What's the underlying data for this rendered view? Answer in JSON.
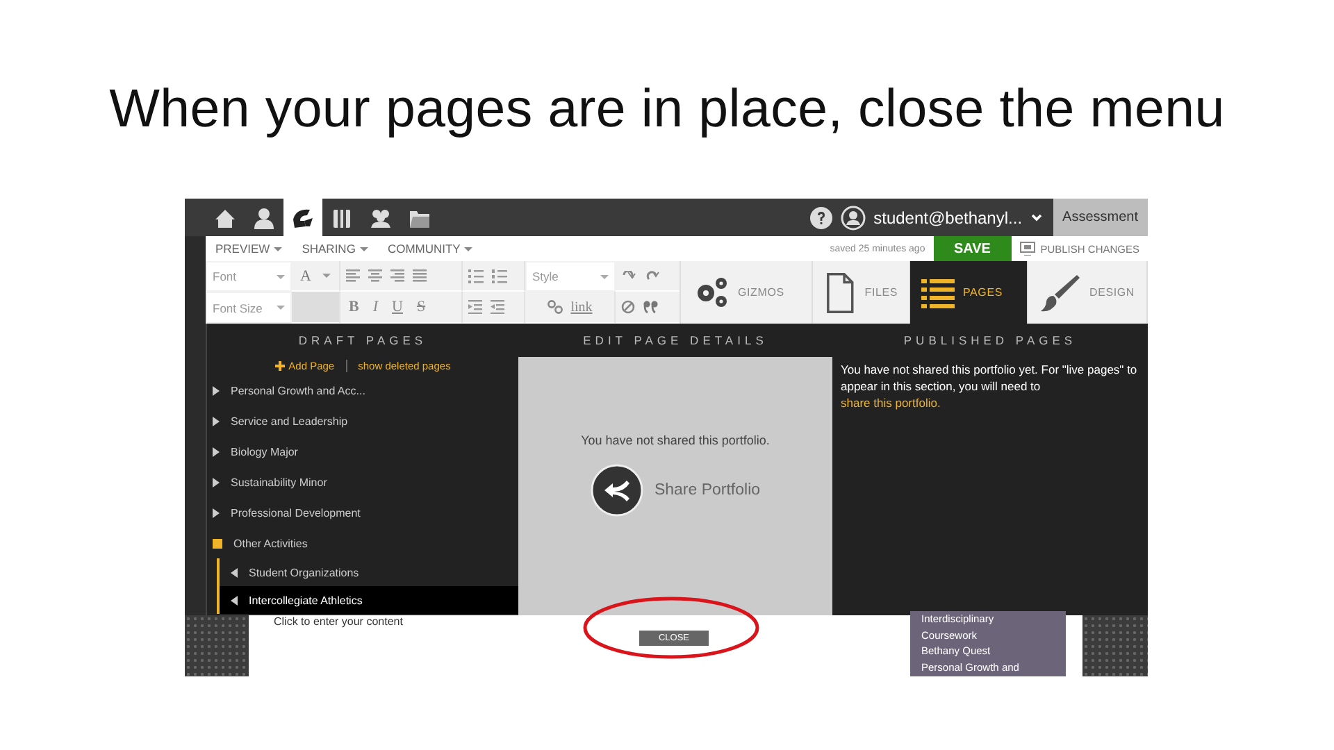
{
  "slide": {
    "title": "When your pages are in place, close the menu"
  },
  "nav_tabs": [
    {
      "selected": false
    },
    {
      "selected": false
    },
    {
      "selected": true
    },
    {
      "selected": false
    },
    {
      "selected": false
    },
    {
      "selected": false
    }
  ],
  "account": {
    "user": "student@bethanyl...",
    "portfolio": "Assessment"
  },
  "menus": [
    "PREVIEW",
    "SHARING",
    "COMMUNITY"
  ],
  "saved_status": "saved 25 minutes ago",
  "save_button": "SAVE",
  "publish_button": "PUBLISH CHANGES",
  "toolbar": {
    "font": "Font",
    "font_size": "Font Size",
    "style": "Style",
    "link": "link",
    "letters": [
      {
        "label": "A",
        "kind": "color"
      },
      {
        "label": "B",
        "kind": "bold"
      },
      {
        "label": "I",
        "kind": "italic"
      },
      {
        "label": "U",
        "kind": "underline"
      },
      {
        "label": "S",
        "kind": "strike"
      }
    ]
  },
  "panel_tabs": [
    {
      "label": "GIZMOS",
      "selected": false
    },
    {
      "label": "FILES",
      "selected": false
    },
    {
      "label": "PAGES",
      "selected": true
    },
    {
      "label": "DESIGN",
      "selected": false
    }
  ],
  "draft_pages": {
    "heading": "DRAFT PAGES",
    "add_page": "Add Page",
    "show_deleted": "show deleted pages",
    "pages": [
      {
        "label": "Personal Growth and Acc...",
        "expanded": false,
        "selected": false
      },
      {
        "label": "Service and Leadership",
        "expanded": false,
        "selected": false
      },
      {
        "label": "Biology Major",
        "expanded": false,
        "selected": false
      },
      {
        "label": "Sustainability Minor",
        "expanded": false,
        "selected": false
      },
      {
        "label": "Professional Development",
        "expanded": false,
        "selected": false
      },
      {
        "label": "Other Activities",
        "expanded": true,
        "selected": false,
        "children": [
          {
            "label": "Student Organizations",
            "selected": false
          },
          {
            "label": "Intercollegiate Athletics",
            "selected": true
          }
        ]
      }
    ]
  },
  "edit_details": {
    "heading": "EDIT PAGE DETAILS",
    "message": "You have not shared this portfolio.",
    "share_button": "Share Portfolio"
  },
  "published": {
    "heading": "PUBLISHED PAGES",
    "message": "You have not shared this portfolio yet. For \"live pages\" to appear in this section, you will need to ",
    "link": "share this portfolio."
  },
  "page_behind": {
    "content_hint": "Click to enter your content",
    "menu_items": [
      "Interdisciplinary",
      "Coursework",
      "Bethany Quest",
      "Personal Growth and"
    ]
  },
  "close_button": "CLOSE"
}
